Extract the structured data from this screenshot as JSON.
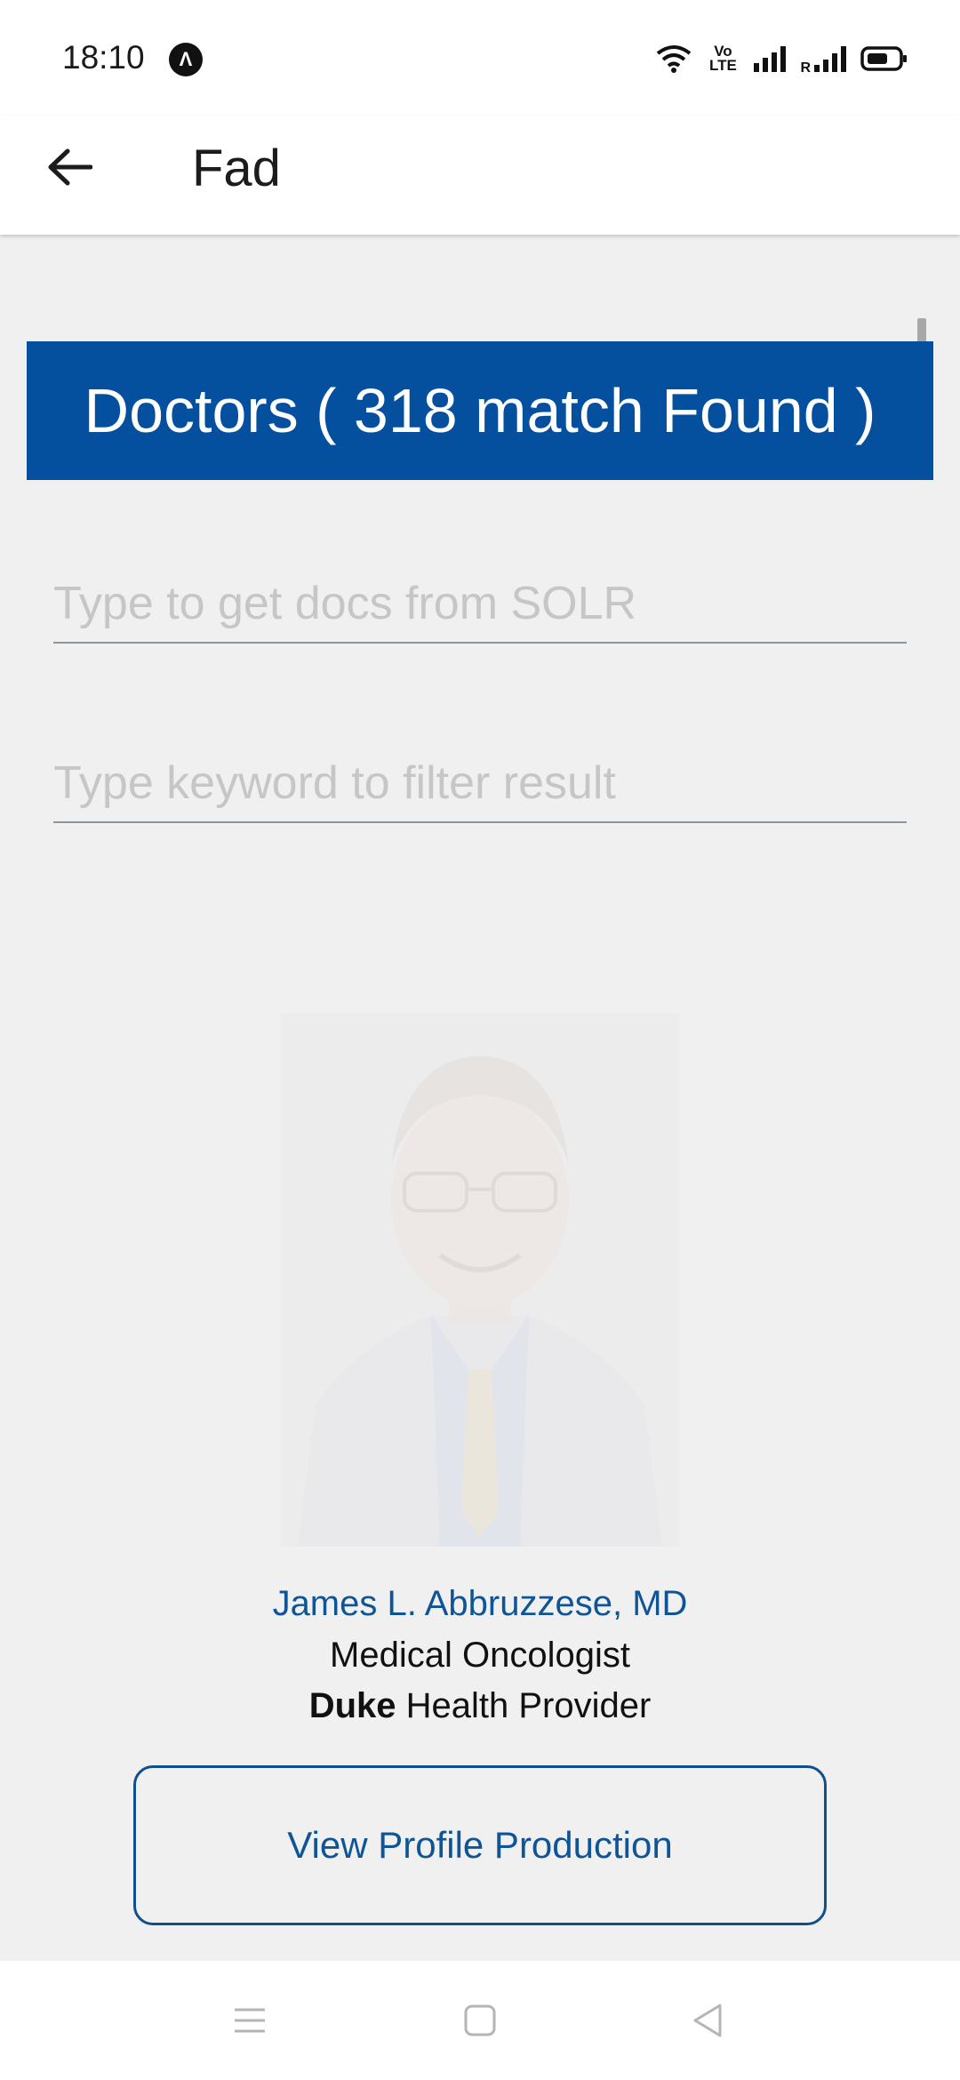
{
  "status_bar": {
    "time": "18:10",
    "app_icon_glyph": "Λ",
    "volte_label": "Vo LTE",
    "roaming_label": "R",
    "icons": [
      "wifi-icon",
      "volte-icon",
      "signal-icon",
      "roaming-signal-icon",
      "battery-icon"
    ]
  },
  "app_bar": {
    "title": "Fad",
    "back_icon": "arrow-left-icon"
  },
  "results": {
    "banner": "Doctors ( 318 match Found )",
    "banner_color": "#04509f"
  },
  "search": {
    "solr_placeholder": "Type to get docs from SOLR",
    "solr_value": "",
    "filter_placeholder": "Type keyword to filter result",
    "filter_value": ""
  },
  "doctor": {
    "name": "James L. Abbruzzese, MD",
    "specialty": "Medical Oncologist",
    "provider_bold": "Duke",
    "provider_rest": " Health Provider",
    "button_label": "View Profile Production"
  },
  "nav_bar": {
    "icons": [
      "menu-icon",
      "home-square-icon",
      "back-triangle-icon"
    ]
  },
  "colors": {
    "accent": "#04509f",
    "link": "#0f5596",
    "background": "#f0f0f0"
  }
}
